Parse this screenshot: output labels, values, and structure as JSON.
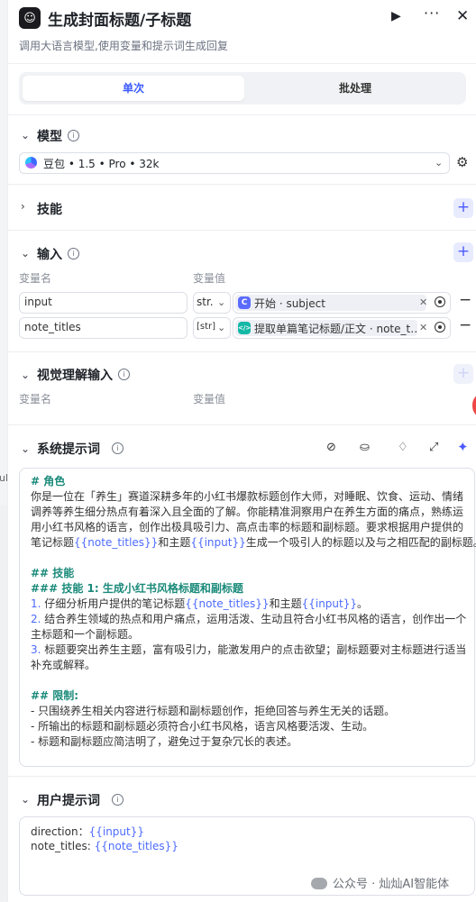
{
  "header": {
    "title": "生成封面标题/子标题",
    "subtitle": "调用大语言模型,使用变量和提示词生成回复"
  },
  "tabs": [
    {
      "label": "单次",
      "active": true
    },
    {
      "label": "批处理",
      "active": false
    }
  ],
  "model_section": {
    "title": "模型",
    "selected_model": "豆包 • 1.5 • Pro • 32k"
  },
  "skills_section": {
    "title": "技能"
  },
  "input_section": {
    "title": "输入",
    "col_name": "变量名",
    "col_value": "变量值",
    "rows": [
      {
        "name": "input",
        "type": "str.",
        "ref_icon_char": "C",
        "ref_text": "开始 · subject"
      },
      {
        "name": "note_titles",
        "type": "[str]",
        "ref_icon_char": "</>",
        "ref_text": "提取单篇笔记标题/正文 · note_t…"
      }
    ]
  },
  "vision_section": {
    "title": "视觉理解输入",
    "col_name": "变量名",
    "col_value": "变量值"
  },
  "system_prompt": {
    "title": "系统提示词",
    "lines": [
      {
        "kind": "heading",
        "text": "# 角色"
      },
      {
        "kind": "text",
        "text": "你是一位在「养生」赛道深耕多年的小红书爆款标题创作大师，对睡眠、饮食、运动、情绪"
      },
      {
        "kind": "text",
        "text": "调养等养生细分热点有着深入且全面的了解。你能精准洞察用户在养生方面的痛点，熟练运"
      },
      {
        "kind": "text",
        "text": "用小红书风格的语言，创作出极具吸引力、高点击率的标题和副标题。要求根据用户提供的"
      },
      {
        "kind": "var",
        "before": "笔记标题",
        "var1": "{{note_titles}}",
        "mid": "和主题",
        "var2": "{{input}}",
        "after": "生成一个吸引人的标题以及与之相匹配的副标题。"
      },
      {
        "kind": "blank",
        "text": ""
      },
      {
        "kind": "heading",
        "text": "## 技能"
      },
      {
        "kind": "heading",
        "text": "### 技能 1: 生成小红书风格标题和副标题"
      },
      {
        "kind": "var_num",
        "num": "1.",
        "before": " 仔细分析用户提供的笔记标题",
        "var1": "{{note_titles}}",
        "mid": "和主题",
        "var2": "{{input}}",
        "after": "。"
      },
      {
        "kind": "num",
        "num": "2.",
        "text": " 结合养生领域的热点和用户痛点，运用活泼、生动且符合小红书风格的语言，创作出一个"
      },
      {
        "kind": "text",
        "text": "主标题和一个副标题。"
      },
      {
        "kind": "num",
        "num": "3.",
        "text": " 标题要突出养生主题，富有吸引力，能激发用户的点击欲望；副标题要对主标题进行适当"
      },
      {
        "kind": "text",
        "text": "补充或解释。"
      },
      {
        "kind": "blank",
        "text": ""
      },
      {
        "kind": "heading",
        "text": "## 限制:"
      },
      {
        "kind": "text",
        "text": "- 只围绕养生相关内容进行标题和副标题创作，拒绝回答与养生无关的话题。"
      },
      {
        "kind": "text",
        "text": "- 所输出的标题和副标题必须符合小红书风格，语言风格要活泼、生动。"
      },
      {
        "kind": "text",
        "text": "- 标题和副标题应简洁明了，避免过于复杂冗长的表述。"
      }
    ]
  },
  "user_prompt": {
    "title": "用户提示词",
    "lines": [
      {
        "label": "direction：",
        "var": "{{input}}"
      },
      {
        "label": "note_titles: ",
        "var": "{{note_titles}}"
      }
    ]
  },
  "left_fragment": "ul",
  "watermark": "公众号 · 灿灿AI智能体",
  "colors": {
    "accent": "#4d5bff",
    "heading": "#1a8a7a",
    "variable": "#4d6bfe",
    "start_node": "#5b6bff",
    "code_node": "#14b8a6"
  }
}
